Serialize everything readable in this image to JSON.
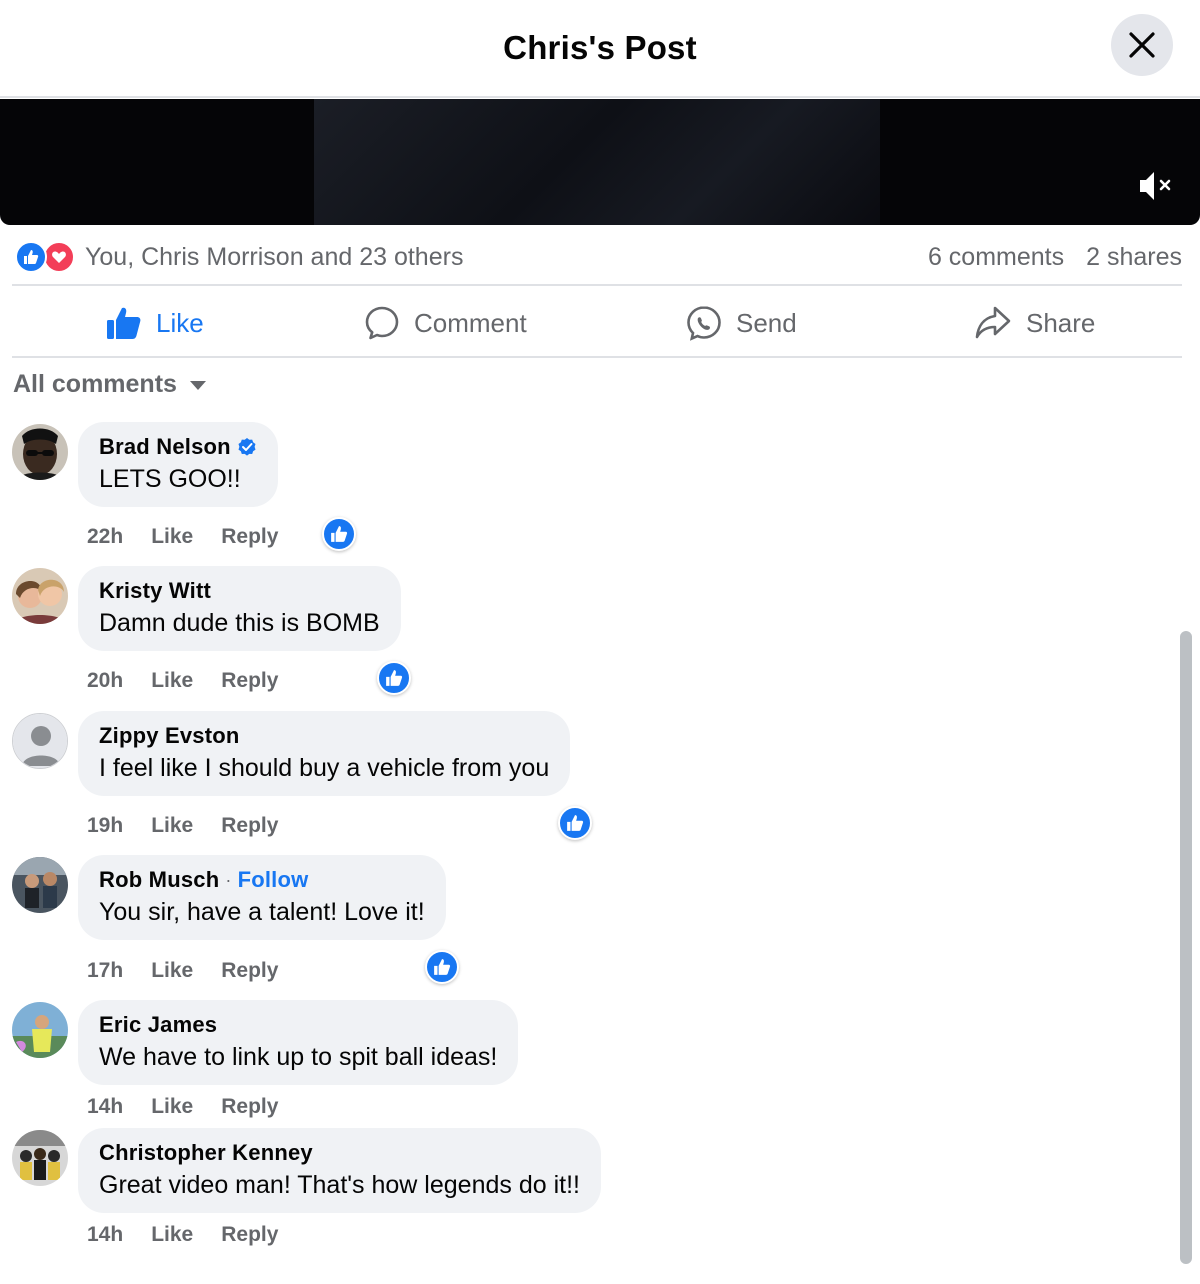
{
  "header": {
    "title": "Chris's Post"
  },
  "summary": {
    "reactions_text": "You, Chris Morrison and 23 others",
    "comments_count": "6 comments",
    "shares_count": "2 shares"
  },
  "actions": [
    {
      "label": "Like",
      "icon": "thumbs-up-icon",
      "active": true
    },
    {
      "label": "Comment",
      "icon": "comment-bubble-icon"
    },
    {
      "label": "Send",
      "icon": "messenger-icon"
    },
    {
      "label": "Share",
      "icon": "share-arrow-icon"
    }
  ],
  "filter": {
    "label": "All comments"
  },
  "comments": [
    {
      "author": "Brad Nelson",
      "verified": true,
      "text": "LETS GOO!!",
      "time": "22h",
      "like_label": "Like",
      "reply_label": "Reply",
      "has_reaction": true
    },
    {
      "author": "Kristy Witt",
      "text": "Damn dude this is BOMB",
      "time": "20h",
      "like_label": "Like",
      "reply_label": "Reply",
      "has_reaction": true
    },
    {
      "author": "Zippy Evston",
      "text": "I feel like I should buy a vehicle from you",
      "time": "19h",
      "like_label": "Like",
      "reply_label": "Reply",
      "has_reaction": true
    },
    {
      "author": "Rob Musch",
      "follow_separator": "·",
      "follow_label": "Follow",
      "text": "You sir, have a talent! Love it!",
      "time": "17h",
      "like_label": "Like",
      "reply_label": "Reply",
      "has_reaction": true
    },
    {
      "author": "Eric James",
      "text": "We have to link up to spit ball ideas!",
      "time": "14h",
      "like_label": "Like",
      "reply_label": "Reply",
      "has_reaction": false
    },
    {
      "author": "Christopher Kenney",
      "text": "Great video man! That's how legends do it!!",
      "time": "14h",
      "like_label": "Like",
      "reply_label": "Reply",
      "has_reaction": false
    }
  ],
  "colors": {
    "accent": "#1877f2",
    "love": "#f33e58",
    "bubble": "#f0f2f5",
    "secondary_text": "#65676b"
  }
}
